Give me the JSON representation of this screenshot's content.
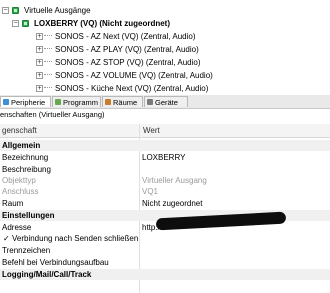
{
  "tree": {
    "root": {
      "label": "Virtuelle Ausgänge"
    },
    "group": {
      "label": "LOXBERRY (VQ) (Nicht zugeordnet)"
    },
    "items": [
      "SONOS - AZ Next (VQ) (Zentral, Audio)",
      "SONOS - AZ PLAY (VQ) (Zentral, Audio)",
      "SONOS - AZ STOP (VQ) (Zentral, Audio)",
      "SONOS - AZ VOLUME (VQ) (Zentral, Audio)",
      "SONOS - Küche Next (VQ) (Zentral, Audio)"
    ]
  },
  "tabs": [
    "Peripherie",
    "Programm",
    "Räume",
    "Geräte"
  ],
  "properties": {
    "title": "enschaften (Virtueller Ausgang)",
    "col_property": "genschaft",
    "col_value": "Wert",
    "rows": [
      {
        "type": "category",
        "key": "Allgemein",
        "value": ""
      },
      {
        "type": "item",
        "key": "Bezeichnung",
        "value": "LOXBERRY"
      },
      {
        "type": "item",
        "key": "Beschreibung",
        "value": ""
      },
      {
        "type": "readonly",
        "key": "Objekttyp",
        "value": "Virtueller Ausgang"
      },
      {
        "type": "readonly",
        "key": "Anschluss",
        "value": "VQ1"
      },
      {
        "type": "item",
        "key": "Raum",
        "value": "Nicht zugeordnet"
      },
      {
        "type": "category",
        "key": "Einstellungen",
        "value": ""
      },
      {
        "type": "item",
        "key": "Adresse",
        "value": "http://"
      },
      {
        "type": "check",
        "key": "Verbindung nach Senden schließen",
        "value": ""
      },
      {
        "type": "item",
        "key": "Trennzeichen",
        "value": ""
      },
      {
        "type": "item",
        "key": "Befehl bei Verbindungsaufbau",
        "value": ""
      },
      {
        "type": "category",
        "key": "Logging/Mail/Call/Track",
        "value": ""
      }
    ]
  },
  "check_mark": "✓"
}
